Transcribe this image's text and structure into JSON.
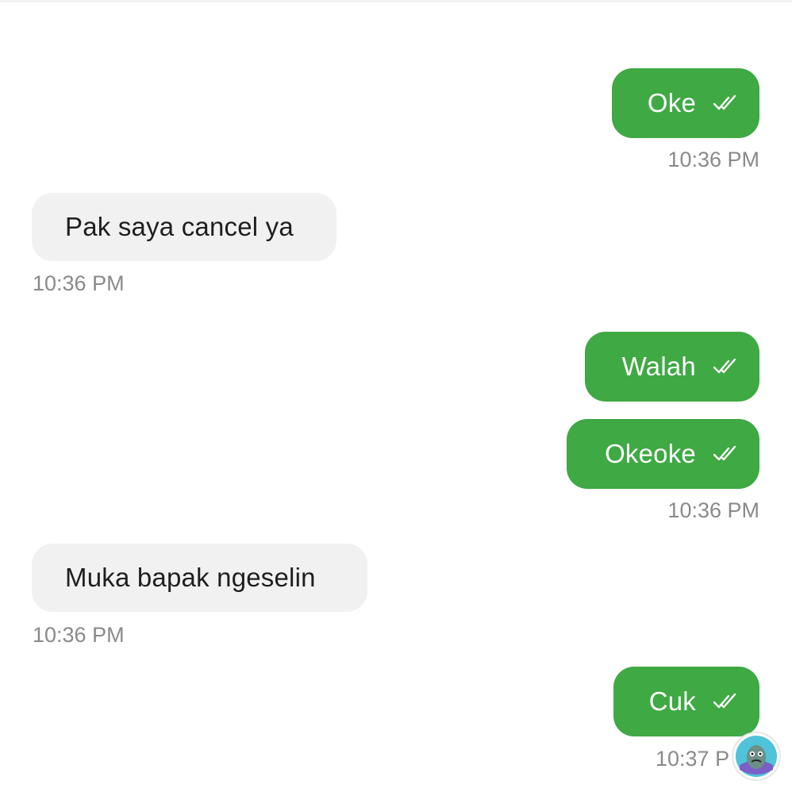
{
  "conversation": {
    "messages": [
      {
        "direction": "outgoing",
        "text": "Oke",
        "status": "read"
      },
      {
        "direction": "incoming",
        "text": "Pak saya cancel ya"
      },
      {
        "direction": "outgoing",
        "text": "Walah",
        "status": "read"
      },
      {
        "direction": "outgoing",
        "text": "Okeoke",
        "status": "read"
      },
      {
        "direction": "incoming",
        "text": "Muka bapak ngeselin"
      },
      {
        "direction": "outgoing",
        "text": "Cuk",
        "status": "read"
      }
    ],
    "timestamps": [
      "10:36 PM",
      "10:36 PM",
      "10:36 PM",
      "10:36 PM",
      "10:37 P"
    ]
  },
  "colors": {
    "outgoing_bubble": "#3fa944",
    "incoming_bubble": "#f1f1f1",
    "timestamp_text": "#8a8a8a"
  },
  "icons": {
    "read_receipt": "double-check-icon",
    "watermark": "avatar-logo-icon"
  }
}
